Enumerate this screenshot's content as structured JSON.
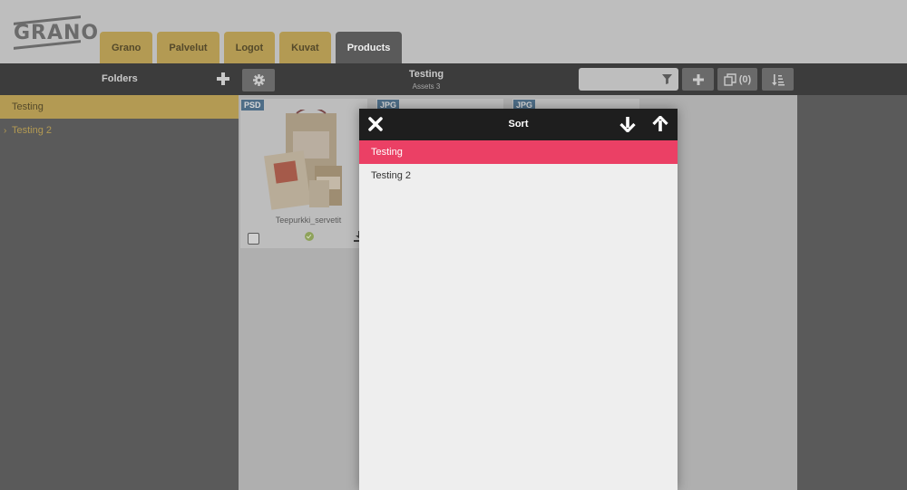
{
  "brand": {
    "logo_text": "GRANO"
  },
  "tabs": [
    {
      "label": "Grano",
      "active": false
    },
    {
      "label": "Palvelut",
      "active": false
    },
    {
      "label": "Logot",
      "active": false
    },
    {
      "label": "Kuvat",
      "active": false
    },
    {
      "label": "Products",
      "active": true
    }
  ],
  "toolbar": {
    "folders_label": "Folders",
    "add_folder_icon": "plus-icon",
    "settings_icon": "gear-icon",
    "current_folder": "Testing",
    "asset_count": "Assets 3",
    "search": {
      "value": "",
      "placeholder": ""
    },
    "filter_icon": "filter-icon",
    "add_icon": "plus-icon",
    "collection_count": "(0)",
    "sort_icon": "sort-icon"
  },
  "sidebar": {
    "items": [
      {
        "label": "Testing",
        "selected": true,
        "has_children": false
      },
      {
        "label": "Testing 2",
        "selected": false,
        "has_children": true
      }
    ]
  },
  "assets": [
    {
      "type": "PSD",
      "name": "Teepurkki_servetit",
      "status": "approved"
    },
    {
      "type": "JPG",
      "name": "",
      "status": ""
    },
    {
      "type": "JPG",
      "name": "",
      "status": ""
    }
  ],
  "sort_modal": {
    "title": "Sort",
    "close_icon": "close-icon",
    "down_icon": "arrow-down-icon",
    "up_icon": "arrow-up-icon",
    "items": [
      {
        "label": "Testing",
        "active": true
      },
      {
        "label": "Testing 2",
        "active": false
      }
    ]
  },
  "colors": {
    "accent_gold": "#b39a53",
    "active_pink": "#eb4065",
    "dark_bar": "#3c3c3c",
    "modal_header": "#1e1e1e"
  }
}
